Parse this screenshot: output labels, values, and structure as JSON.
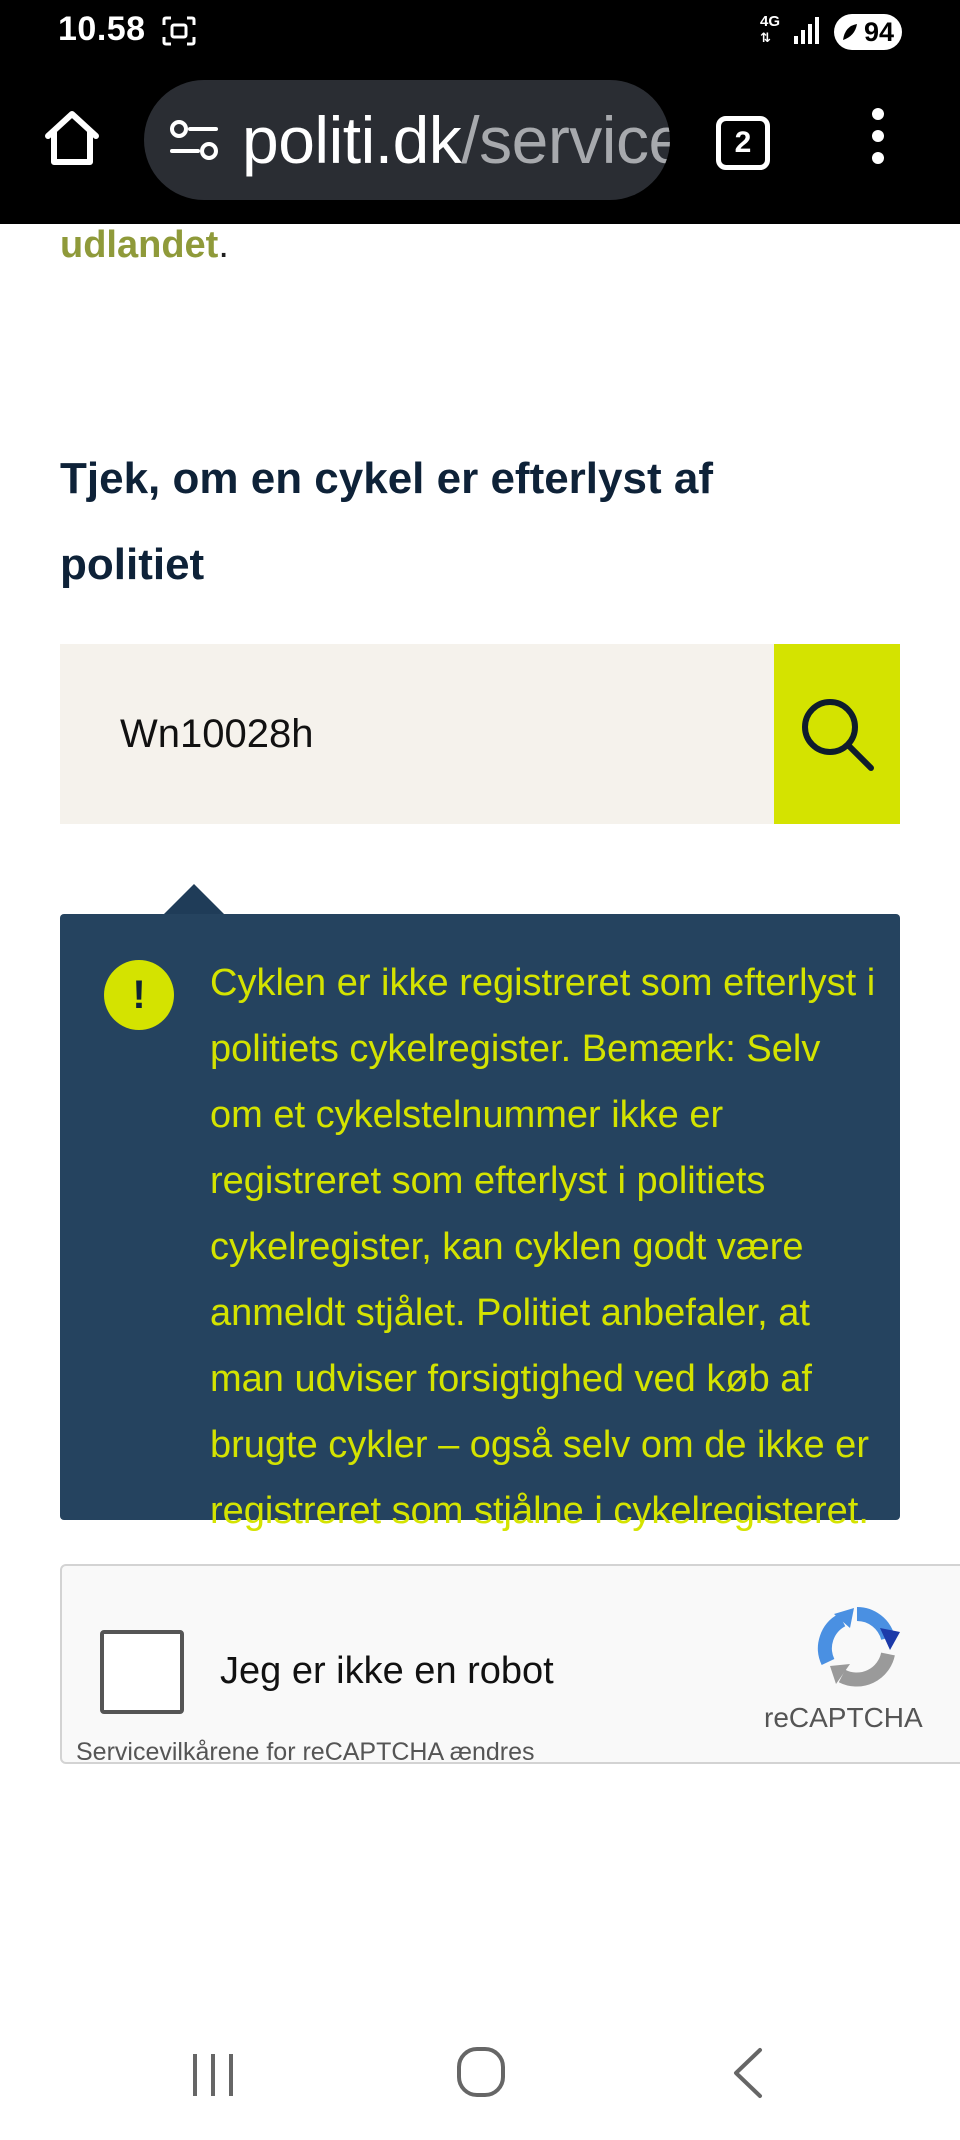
{
  "status_bar": {
    "time": "10.58",
    "network": "4G",
    "battery": "94",
    "icons": [
      "screenshot-icon",
      "signal-icon",
      "battery-saver-icon"
    ]
  },
  "browser": {
    "url_host": "politi.dk",
    "url_path": "/service",
    "tab_count": "2",
    "icons": [
      "home-icon",
      "site-settings-icon",
      "tabs-icon",
      "more-menu-icon"
    ]
  },
  "page": {
    "link_fragment": "udlandet",
    "link_suffix": ".",
    "heading": "Tjek, om en cykel er efterlyst af politiet",
    "search": {
      "value": "Wn10028h",
      "button_icon": "search-icon"
    },
    "alert": {
      "icon": "!",
      "message": "Cyklen er ikke registreret som efterlyst i politiets cykelregister. Bemærk: Selv om et cykelstelnummer ikke er registreret som efterlyst i politiets cykelregister, kan cyklen godt være anmeldt stjålet. Politiet anbefaler, at man udviser forsigtighed ved køb af brugte cykler – også selv om de ikke er registreret som stjålne i cykelregisteret."
    },
    "captcha": {
      "label": "Jeg er ikke en robot",
      "brand": "reCAPTCHA",
      "terms": "Servicevilkårene for reCAPTCHA ændres"
    }
  },
  "nav_bar": {
    "icons": [
      "recents-icon",
      "home-nav-icon",
      "back-icon"
    ]
  },
  "colors": {
    "accent_lime": "#d4e300",
    "alert_bg": "#25435f",
    "heading": "#0e2238",
    "link_olive": "#8f9a3a",
    "search_bg": "#f5f2ec"
  }
}
